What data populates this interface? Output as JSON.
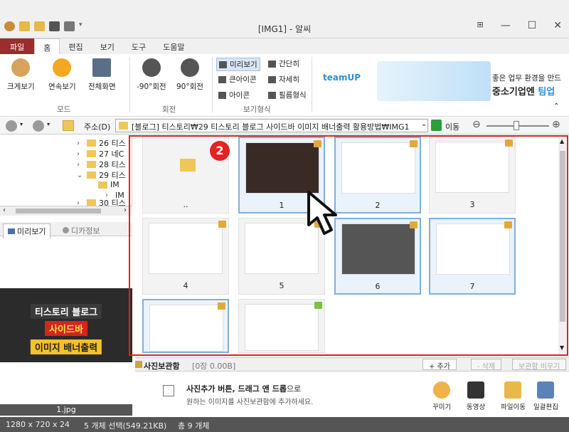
{
  "window": {
    "title": "[IMG1] - 알씨"
  },
  "menu": {
    "file": "파일",
    "tabs": [
      "홈",
      "편집",
      "보기",
      "도구",
      "도움말"
    ]
  },
  "ribbon": {
    "big_view": "크게보기",
    "slideshow": "연속보기",
    "fullscreen": "전체화면",
    "group_mode": "모드",
    "rot_left": "-90°회전",
    "rot_right": "90°회전",
    "group_rotate": "회전",
    "view_opts": [
      "미리보기",
      "간단히",
      "큰아이콘",
      "자세히",
      "아이콘",
      "필름형식"
    ],
    "group_view": "보기형식",
    "ad": {
      "brand": "teamUP",
      "line1": "좋은 업무 환경을 만드",
      "line2_a": "중소기업엔 ",
      "line2_b": "팀업"
    }
  },
  "address": {
    "label": "주소(D)",
    "path": "[블로그] 티스토리₩29 티스토리 블로그 사이드바 이미지 배너출력 활용방법₩IMG1",
    "go": "이동"
  },
  "tree": {
    "items": [
      "26 티스",
      "27 네C",
      "28 티스",
      "29 티스",
      "IM",
      "IM",
      "30 티스"
    ]
  },
  "preview_tabs": [
    "미리보기",
    "디카정보"
  ],
  "preview": {
    "line1": "티스토리 블로그",
    "line2": "사이드바",
    "line3": "이미지 배너출력",
    "filename": "1.jpg"
  },
  "thumbs": {
    "captions": [
      "..",
      "1",
      "2",
      "3",
      "4",
      "5",
      "6",
      "7",
      "",
      ""
    ]
  },
  "badge": "2",
  "photobox": {
    "title": "사진보관함",
    "count": "[0장 0.00B]",
    "add": "+ 추가",
    "delete": "- 삭제",
    "clear": "보관함 비우기",
    "hint_bold": "사진추가 버튼, 드래그 앤 드롭",
    "hint_suffix": "으로",
    "hint2": "원하는 이미지를 사진보관함에 추가하세요.",
    "tools": [
      "꾸미기",
      "동영상",
      "파일이동",
      "일괄편집"
    ]
  },
  "status": {
    "resolution": "1280 x 720 x 24",
    "selection": "5 개체 선택(549.21KB)",
    "total": "총 9 개체"
  },
  "colors": {
    "accent": "#9b2d2d",
    "highlight": "#e02020",
    "selection": "#7fb0dc"
  }
}
